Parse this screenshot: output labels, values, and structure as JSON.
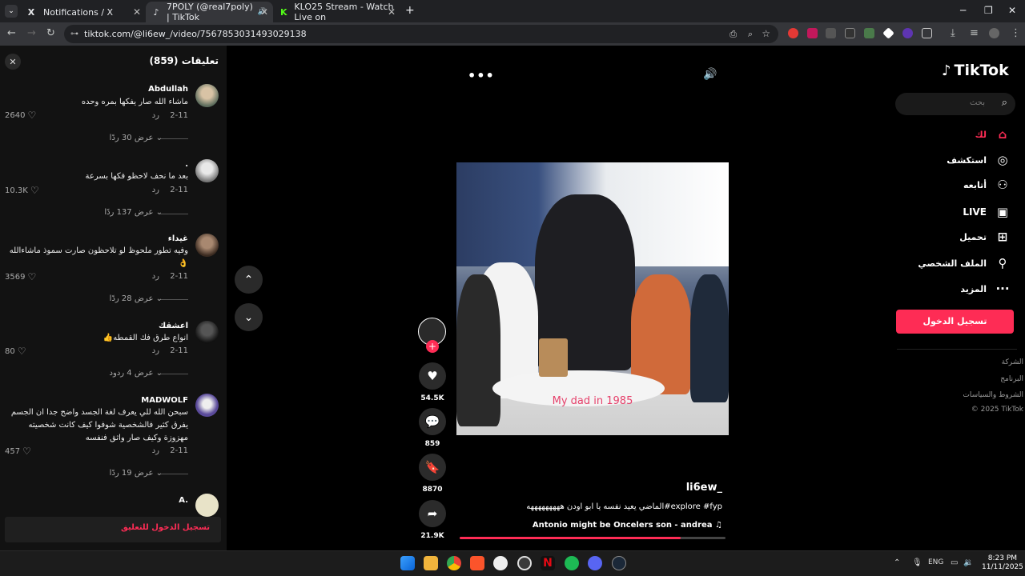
{
  "browser": {
    "tabs": [
      {
        "title": "Notifications / X",
        "icon": "x-logo-icon",
        "active": false
      },
      {
        "title": "7POLY (@real7poly) | TikTok",
        "icon": "tiktok-logo-icon",
        "active": true
      },
      {
        "title": "KLO25 Stream - Watch Live on",
        "icon": "kick-logo-icon",
        "active": false
      }
    ],
    "url": "tiktok.com/@li6ew_/video/7567853031493029138"
  },
  "comments": {
    "title": "تعليقات (859)",
    "items": [
      {
        "user": "Abdullah",
        "text": "ماشاء الله صار يفكها بمره وحده",
        "date": "2-11",
        "reply": "رد",
        "likes": "2640",
        "view_replies": "عرض 30 ردًا"
      },
      {
        "user": ".",
        "text": "بعد ما نحف لاحظو فكها بسرعة",
        "date": "2-11",
        "reply": "رد",
        "likes": "10.3K",
        "view_replies": "عرض 137 ردًا"
      },
      {
        "user": "غيداء",
        "text": "وفيه تطور ملحوظ لو تلاحظون صارت سموذ ماشاءالله 👌",
        "date": "2-11",
        "reply": "رد",
        "likes": "3569",
        "view_replies": "عرض 28 ردًا"
      },
      {
        "user": "اعشقك",
        "text": "انواع طرق فك القمطه👍",
        "date": "2-11",
        "reply": "رد",
        "likes": "80",
        "view_replies": "عرض 4 ردود"
      },
      {
        "user": "MADWOLF",
        "text": "سبحن الله للي يعرف لغة الجسد واضح جدا ان الجسم يفرق كثير فالشخصية شوفوا كيف كانت شخصيته مهزوزة وكيف صار واثق فنفسه",
        "date": "2-11",
        "reply": "رد",
        "likes": "457",
        "view_replies": "عرض 19 ردًا"
      },
      {
        "user": "A."
      }
    ],
    "login_prompt": "تسجيل الدخول للتعليق"
  },
  "video": {
    "caption": "My dad in 1985",
    "author": "li6ew_",
    "description": "الماضي يعيد نفسه يا ابو اودن هههههههههه#explore #fyp",
    "music": "Antonio might be Oncelers son - andrea",
    "progress": 0.83,
    "likes": "54.5K",
    "comments": "859",
    "saves": "8870",
    "shares": "21.9K"
  },
  "nav": {
    "logo": "TikTok",
    "search_placeholder": "بحث",
    "items": [
      {
        "label": "لك",
        "icon": "home-icon",
        "active": true
      },
      {
        "label": "استكشف",
        "icon": "compass-icon"
      },
      {
        "label": "أتابعه",
        "icon": "following-icon"
      },
      {
        "label": "LIVE",
        "icon": "live-icon"
      },
      {
        "label": "تحميل",
        "icon": "upload-icon"
      },
      {
        "label": "الملف الشخصي",
        "icon": "profile-icon"
      },
      {
        "label": "المزيد",
        "icon": "more-icon"
      }
    ],
    "login_button": "تسجيل الدخول",
    "footer": [
      "الشركة",
      "البرنامج",
      "الشروط والسياسات",
      "© 2025 TikTok"
    ]
  },
  "taskbar": {
    "language": "ENG",
    "time": "8:23 PM",
    "date": "11/11/2025"
  },
  "colors": {
    "accent": "#fe2c55",
    "panel": "#121212",
    "chrome": "#202124"
  }
}
